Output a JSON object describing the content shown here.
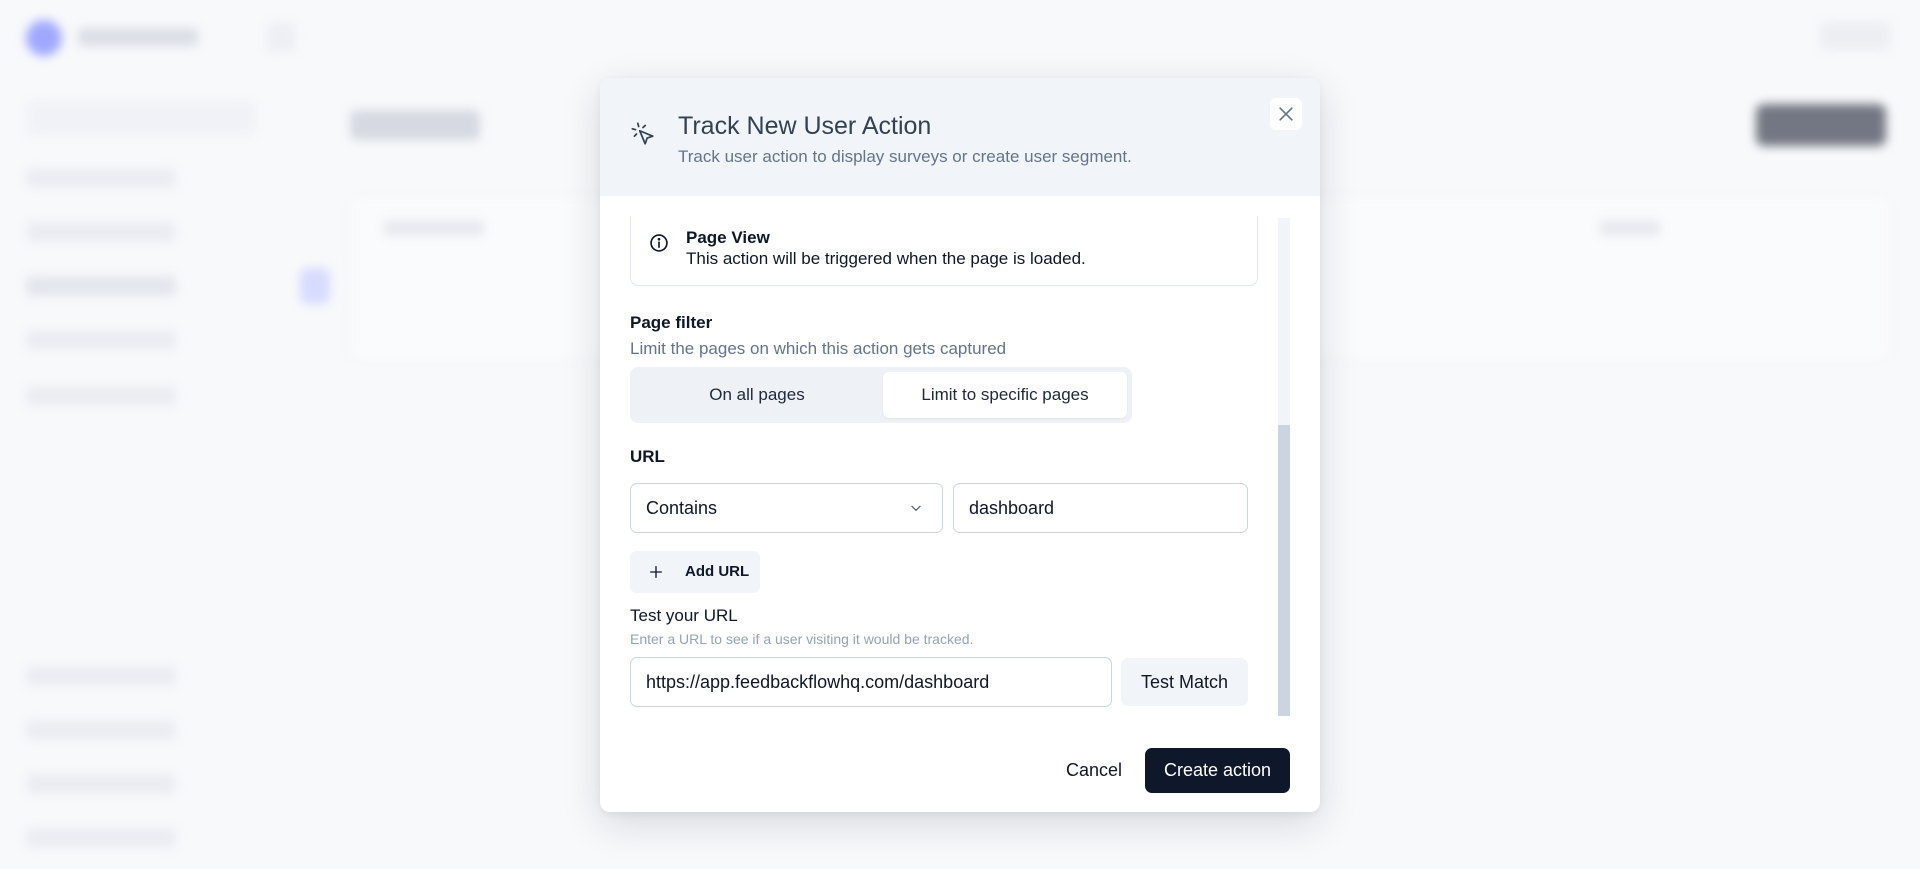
{
  "modal": {
    "title": "Track New User Action",
    "subtitle": "Track user action to display surveys or create user segment.",
    "header_icon": "cursor-click-icon",
    "close_icon": "close-icon"
  },
  "action_type": {
    "icon": "info-icon",
    "title": "Page View",
    "description": "This action will be triggered when the page is loaded."
  },
  "page_filter": {
    "label": "Page filter",
    "help": "Limit the pages on which this action gets captured",
    "options": [
      "On all pages",
      "Limit to specific pages"
    ],
    "selected": "Limit to specific pages"
  },
  "url": {
    "label": "URL",
    "rule_selected": "Contains",
    "rule_icon": "chevron-down-icon",
    "value": "dashboard",
    "add_label": "Add URL",
    "add_icon": "plus-icon"
  },
  "test": {
    "label": "Test your URL",
    "help": "Enter a URL to see if a user visiting it would be tracked.",
    "value": "https://app.feedbackflowhq.com/dashboard",
    "button_label": "Test Match"
  },
  "footer": {
    "cancel_label": "Cancel",
    "create_label": "Create action"
  },
  "colors": {
    "primary": "#0f172a",
    "header_bg": "#f1f4f8",
    "muted_text": "#64748b",
    "border": "#cbd5e1"
  }
}
